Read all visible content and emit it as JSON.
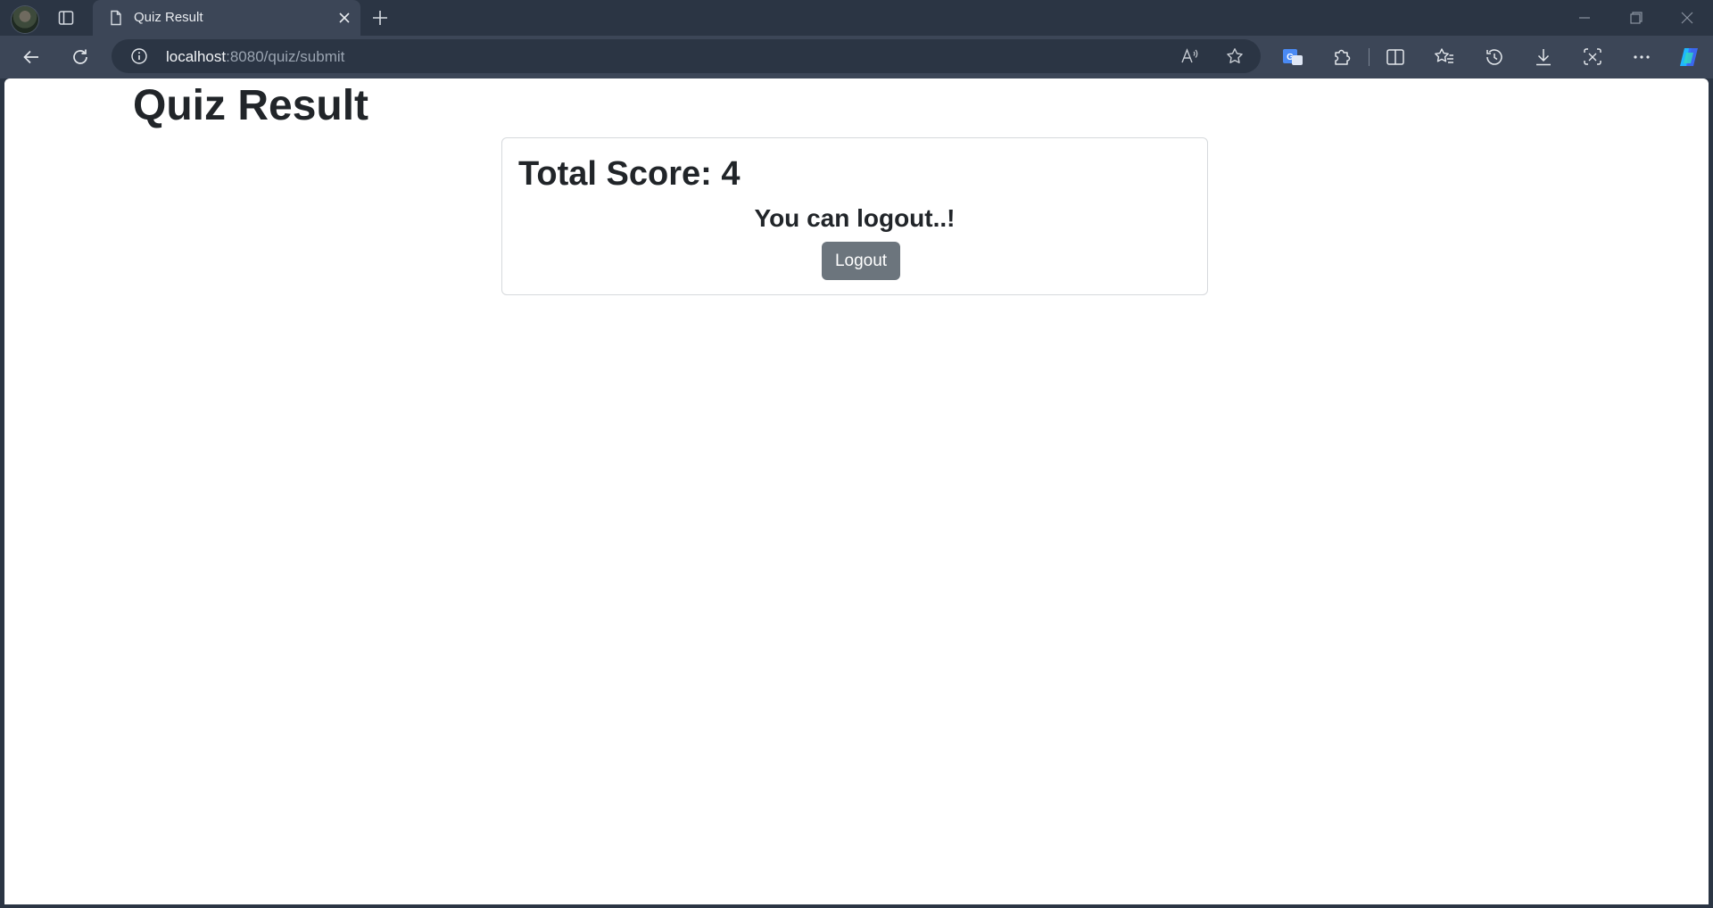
{
  "browser": {
    "tab_title": "Quiz Result",
    "url_host": "localhost",
    "url_rest": ":8080/quiz/submit"
  },
  "page": {
    "heading": "Quiz Result",
    "score_text": "Total Score: 4",
    "message": "You can logout..!",
    "logout_label": "Logout"
  },
  "colors": {
    "chrome_dark": "#2b3544",
    "chrome_tab": "#3c4657",
    "button_secondary": "#6c757d",
    "text_dark": "#212529"
  },
  "icons": {
    "titlebar": [
      "profile-avatar",
      "tab-actions-icon",
      "page-icon",
      "close-tab-icon",
      "new-tab-icon",
      "minimize-icon",
      "restore-icon",
      "close-window-icon"
    ],
    "toolbar": [
      "back-icon",
      "refresh-icon",
      "info-icon",
      "read-aloud-icon",
      "favorite-star-icon",
      "translate-icon",
      "extensions-icon",
      "split-screen-icon",
      "favorites-icon",
      "history-icon",
      "downloads-icon",
      "screenshot-icon",
      "more-icon",
      "copilot-icon"
    ]
  }
}
